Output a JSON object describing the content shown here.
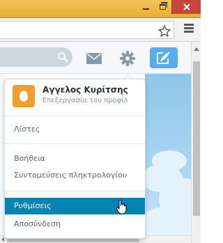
{
  "titlebar": {
    "color_accent": "#e8ac34",
    "buttons": [
      {
        "name": "minimize",
        "icon": "minimize-icon"
      },
      {
        "name": "maximize",
        "icon": "maximize-icon"
      },
      {
        "name": "close",
        "icon": "close-icon"
      }
    ]
  },
  "toolbar": {
    "address_value": "",
    "bookmark_icon": "star-icon",
    "menu_icon": "hamburger-icon"
  },
  "twitter_header": {
    "search_placeholder": "",
    "icons": [
      "search-icon",
      "mail-icon",
      "gear-icon",
      "compose-icon"
    ],
    "brand_color": "#55acee"
  },
  "dropdown": {
    "profile": {
      "name": "Αγγελος Κυρίτσης",
      "subtitle": "Επεξεργασία του προφίλ",
      "avatar_color": "#f19e2a"
    },
    "items": [
      {
        "label": "Λίστες",
        "active": false
      },
      {
        "label": "Βοήθεια",
        "active": false
      },
      {
        "label": "Συντομεύσεις πληκτρολογίου",
        "active": false
      },
      {
        "label": "Ρυθμίσεις",
        "active": true
      },
      {
        "label": "Αποσύνδεση",
        "active": false
      }
    ],
    "highlight_color": "#0084b4"
  }
}
